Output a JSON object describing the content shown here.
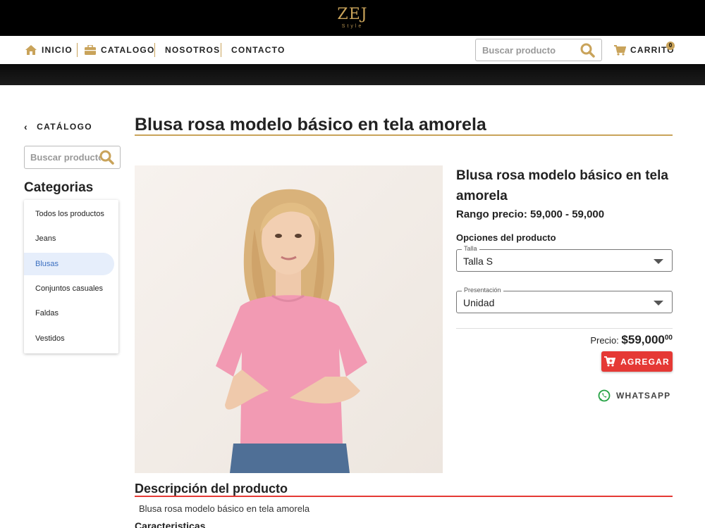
{
  "brand": {
    "logo_text": "ZEJ",
    "logo_sub": "Style"
  },
  "nav": {
    "items": [
      {
        "label": "INICIO",
        "icon": "home-icon"
      },
      {
        "label": "CATALOGO",
        "icon": "briefcase-icon"
      },
      {
        "label": "NOSOTROS"
      },
      {
        "label": "CONTACTO"
      }
    ],
    "search_placeholder": "Buscar producto",
    "cart_label": "CARRITO",
    "cart_count": "0"
  },
  "sidebar": {
    "back_label": "CATÁLOGO",
    "search_placeholder": "Buscar producto",
    "categories_title": "Categorias",
    "categories": [
      {
        "label": "Todos los productos"
      },
      {
        "label": "Jeans"
      },
      {
        "label": "Blusas",
        "active": true
      },
      {
        "label": "Conjuntos casuales"
      },
      {
        "label": "Faldas"
      },
      {
        "label": "Vestidos"
      }
    ]
  },
  "page": {
    "title": "Blusa rosa modelo básico en tela amorela"
  },
  "product": {
    "name": "Blusa rosa modelo básico en tela amorela",
    "price_range": "Rango precio: 59,000 - 59,000",
    "options_title": "Opciones del producto",
    "options": [
      {
        "legend": "Talla",
        "value": "Talla S"
      },
      {
        "legend": "Presentación",
        "value": "Unidad"
      }
    ],
    "price_label": "Precio:",
    "price_value": "$59,000",
    "price_cents": "00",
    "add_label": "AGREGAR",
    "whatsapp_label": "WHATSAPP"
  },
  "description": {
    "title": "Descripción del producto",
    "text": "Blusa rosa modelo básico en tela amorela",
    "characteristics_title": "Caracteristicas"
  },
  "colors": {
    "gold": "#c9a35a",
    "red": "#e53935",
    "active_bg": "#e6eefb",
    "active_text": "#3b6fc0",
    "whatsapp": "#25a244"
  }
}
